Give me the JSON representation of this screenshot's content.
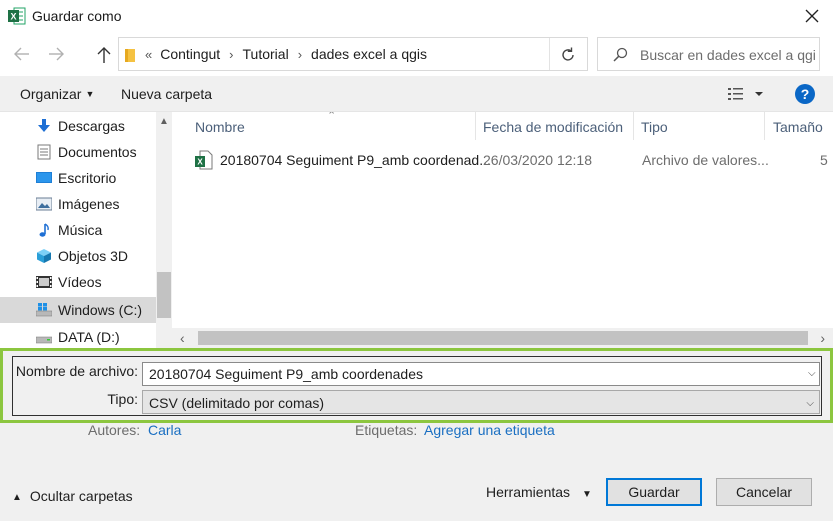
{
  "window": {
    "title": "Guardar como",
    "app_icon": "excel-icon",
    "close_icon": "close-icon"
  },
  "nav": {
    "back_icon": "arrow-left-icon",
    "forward_icon": "arrow-right-icon",
    "up_icon": "arrow-up-icon",
    "breadcrumb_overflow": "«",
    "breadcrumbs": [
      "Contingut",
      "Tutorial",
      "dades excel a qgis"
    ],
    "refresh_icon": "refresh-icon",
    "search_placeholder": "Buscar en dades excel a qgis"
  },
  "toolbar": {
    "organize": "Organizar",
    "new_folder": "Nueva carpeta",
    "views_icon": "view-options-icon",
    "help": "?"
  },
  "sidebar": {
    "items": [
      {
        "label": "Descargas",
        "icon": "download-icon"
      },
      {
        "label": "Documentos",
        "icon": "documents-icon"
      },
      {
        "label": "Escritorio",
        "icon": "desktop-icon"
      },
      {
        "label": "Imágenes",
        "icon": "pictures-icon"
      },
      {
        "label": "Música",
        "icon": "music-icon"
      },
      {
        "label": "Objetos 3D",
        "icon": "3d-objects-icon"
      },
      {
        "label": "Vídeos",
        "icon": "videos-icon"
      },
      {
        "label": "Windows (C:)",
        "icon": "windows-drive-icon",
        "selected": true
      },
      {
        "label": "DATA (D:)",
        "icon": "drive-icon"
      }
    ]
  },
  "filelist": {
    "columns": [
      "Nombre",
      "Fecha de modificación",
      "Tipo",
      "Tamaño"
    ],
    "rows": [
      {
        "name": "20180704 Seguiment P9_amb coordenad...",
        "date": "26/03/2020 12:18",
        "type": "Archivo de valores...",
        "size": "5",
        "icon": "excel-csv-file-icon"
      }
    ]
  },
  "form": {
    "filename_label": "Nombre de archivo:",
    "filename_value": "20180704 Seguiment P9_amb coordenades",
    "type_label": "Tipo:",
    "type_value": "CSV (delimitado por comas)"
  },
  "meta": {
    "authors_label": "Autores:",
    "authors_value": "Carla",
    "tags_label": "Etiquetas:",
    "tags_value": "Agregar una etiqueta"
  },
  "footer": {
    "hide_folders": "Ocultar carpetas",
    "tools": "Herramientas",
    "save": "Guardar",
    "cancel": "Cancelar"
  },
  "colors": {
    "highlight_border": "#8cc63f",
    "accent": "#0078d7",
    "link": "#1a6fc2"
  }
}
